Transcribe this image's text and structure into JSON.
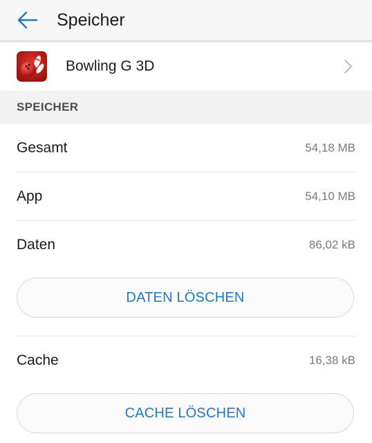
{
  "header": {
    "title": "Speicher",
    "back_icon": "arrow-left-icon",
    "accent_color": "#1e78c8"
  },
  "app": {
    "name": "Bowling G 3D",
    "icon": "bowling-app-icon",
    "chevron_icon": "chevron-right-icon"
  },
  "storage": {
    "section_title": "SPEICHER",
    "total_label": "Gesamt",
    "total_value": "54,18 MB",
    "app_label": "App",
    "app_value": "54,10 MB",
    "data_label": "Daten",
    "data_value": "86,02 kB",
    "clear_data_button": "DATEN LÖSCHEN",
    "cache_label": "Cache",
    "cache_value": "16,38 kB",
    "clear_cache_button": "CACHE LÖSCHEN"
  }
}
